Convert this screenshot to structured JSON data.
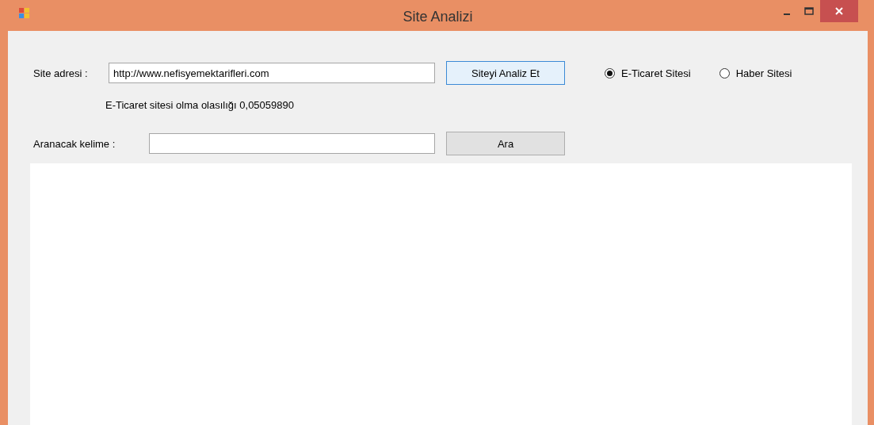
{
  "window": {
    "title": "Site Analizi"
  },
  "site_address": {
    "label": "Site adresi :",
    "value": "http://www.nefisyemektarifleri.com"
  },
  "analyze_button": {
    "label": "Siteyi Analiz Et",
    "focused": true
  },
  "radios": [
    {
      "label": "E-Ticaret Sitesi",
      "selected": true
    },
    {
      "label": "Haber Sitesi",
      "selected": false
    }
  ],
  "result": "E-Ticaret sitesi olma olasılığı 0,05059890",
  "search": {
    "label": "Aranacak kelime :",
    "button": "Ara"
  }
}
